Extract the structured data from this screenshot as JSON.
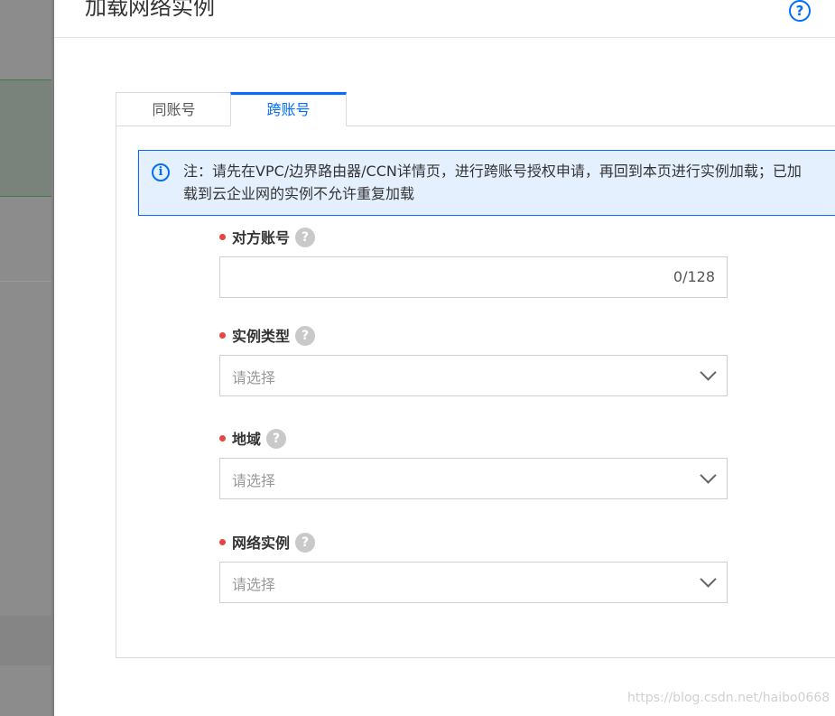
{
  "dialog": {
    "title": "加载网络实例",
    "help_icon": "?"
  },
  "tabs": [
    {
      "label": "同账号",
      "active": false
    },
    {
      "label": "跨账号",
      "active": true
    }
  ],
  "notice": {
    "icon": "i",
    "text": "注：请先在VPC/边界路由器/CCN详情页，进行跨账号授权申请，再回到本页进行实例加载；已加载到云企业网的实例不允许重复加载"
  },
  "fields": [
    {
      "label": "对方账号",
      "required": true,
      "help_icon": "?",
      "type": "text",
      "value": "",
      "counter": "0/128"
    },
    {
      "label": "实例类型",
      "required": true,
      "help_icon": "?",
      "type": "select",
      "placeholder": "请选择"
    },
    {
      "label": "地域",
      "required": true,
      "help_icon": "?",
      "type": "select",
      "placeholder": "请选择"
    },
    {
      "label": "网络实例",
      "required": true,
      "help_icon": "?",
      "type": "select",
      "placeholder": "请选择"
    }
  ],
  "watermark": "https://blog.csdn.net/haibo0668",
  "colors": {
    "accent": "#006eff",
    "required": "#e54545",
    "notice_bg": "#e5f0ff"
  }
}
